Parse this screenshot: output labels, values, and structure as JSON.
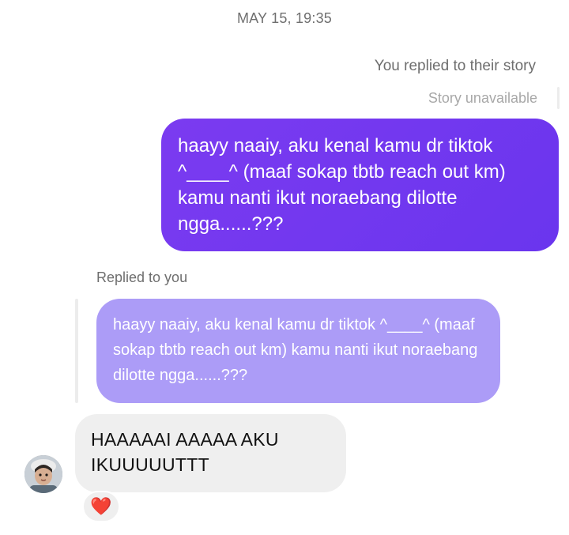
{
  "thread": {
    "timestamp": "MAY 15, 19:35"
  },
  "story_reply": {
    "note": "You replied to their story",
    "status": "Story unavailable"
  },
  "outgoing": {
    "text": "haayy naaiy, aku kenal kamu dr tiktok ^____^ (maaf sokap tbtb reach out km) kamu nanti ikut noraebang dilotte ngga......???",
    "color": "#7038ef"
  },
  "reply": {
    "label": "Replied to you",
    "quoted_text": "haayy naaiy, aku kenal kamu dr tiktok ^____^ (maaf sokap tbtb reach out km) kamu nanti ikut noraebang dilotte ngga......???",
    "quote_color": "#ac9cf7"
  },
  "incoming": {
    "text": "HAAAAAI AAAAA AKU IKUUUUUTTT",
    "avatar_icon": "user-avatar",
    "reaction": "❤️",
    "reaction_icon": "red-heart-icon"
  }
}
